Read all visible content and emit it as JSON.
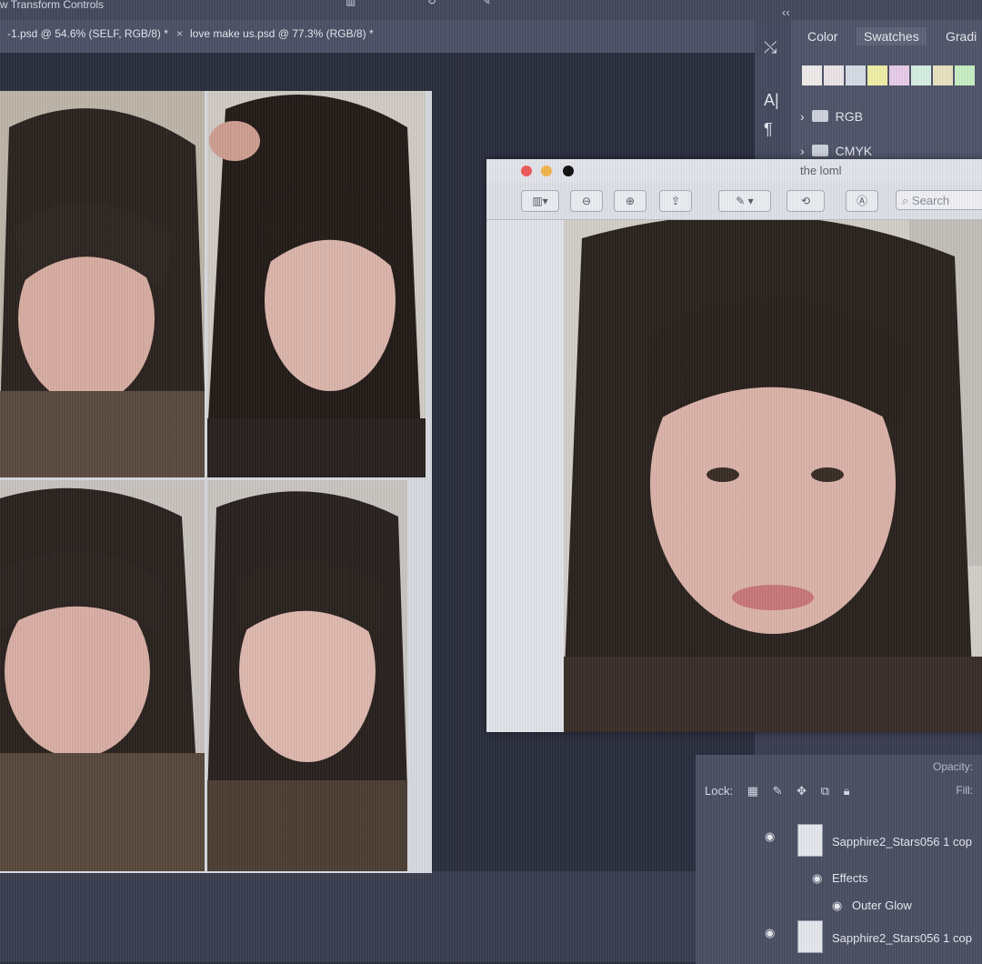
{
  "option_bar": {
    "title": "w Transform Controls"
  },
  "tabs": [
    {
      "label": "-1.psd @ 54.6% (SELF, RGB/8) *"
    },
    {
      "close": "×",
      "label": "love make us.psd @ 77.3% (RGB/8) *"
    }
  ],
  "collapse_glyph": "‹‹",
  "toolstrip": {
    "tools": [
      "⤯",
      "A|",
      "¶"
    ]
  },
  "panels": {
    "tabs": [
      "Color",
      "Swatches",
      "Gradi"
    ],
    "active_tab": "Swatches",
    "swatch_colors": [
      "#f0ecec",
      "#ece6e8",
      "#d8dde8",
      "#f1f0a8",
      "#e9cdea",
      "#d7f0e4",
      "#eae4c2",
      "#c8f0c6",
      "#dbeaf2"
    ],
    "folders": [
      "RGB",
      "CMYK"
    ]
  },
  "preview_window": {
    "title": "the loml",
    "search_placeholder": "Search",
    "traffic_colors": [
      "#f05a5a",
      "#f2b54a",
      "#111111"
    ]
  },
  "layers": {
    "opacity_label": "Opacity:",
    "lock_label": "Lock:",
    "fill_label": "Fill:",
    "items": [
      {
        "name": "Sapphire2_Stars056 1 cop"
      },
      {
        "name": "Effects"
      },
      {
        "name": "Outer Glow"
      },
      {
        "name": "Sapphire2_Stars056 1 cop"
      }
    ]
  }
}
